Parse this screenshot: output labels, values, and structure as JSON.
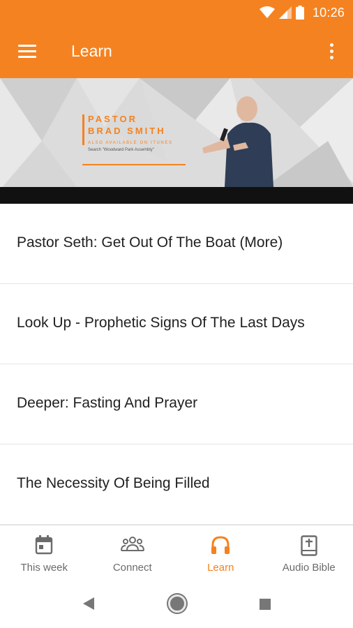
{
  "status_bar": {
    "time": "10:26",
    "icons": [
      "wifi-icon",
      "signal-icon",
      "battery-icon"
    ]
  },
  "app_bar": {
    "title": "Learn",
    "menu_icon": "hamburger-menu-icon",
    "overflow_icon": "more-vert-icon"
  },
  "banner": {
    "title_line1": "PASTOR",
    "title_line2": "BRAD SMITH",
    "subtitle": "ALSO AVAILABLE ON ITUNES",
    "search_hint": "Search \"Woodward Park Assembly\""
  },
  "list": {
    "items": [
      {
        "title": "Pastor Seth: Get Out Of The Boat (More)"
      },
      {
        "title": "Look Up - Prophetic Signs Of The Last Days"
      },
      {
        "title": "Deeper: Fasting And Prayer"
      },
      {
        "title": "The Necessity Of Being Filled"
      }
    ]
  },
  "bottom_nav": {
    "items": [
      {
        "label": "This week",
        "icon": "calendar-icon"
      },
      {
        "label": "Connect",
        "icon": "people-icon"
      },
      {
        "label": "Learn",
        "icon": "headphones-icon",
        "active": true
      },
      {
        "label": "Audio Bible",
        "icon": "bible-icon"
      }
    ]
  },
  "colors": {
    "brand": "#f58220",
    "text_primary": "#212121",
    "nav_inactive": "#6b6b6b",
    "divider": "#e6e6e6"
  },
  "system_nav": [
    "back-icon",
    "home-icon",
    "recents-icon"
  ]
}
